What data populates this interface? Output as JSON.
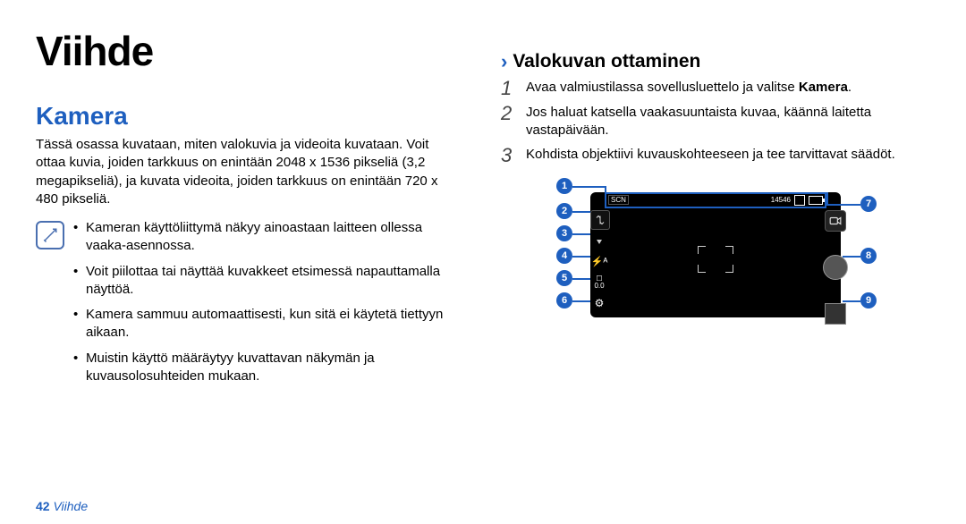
{
  "page_title": "Viihde",
  "left_column": {
    "section_heading": "Kamera",
    "intro": "Tässä osassa kuvataan, miten valokuvia ja videoita kuvataan. Voit ottaa kuvia, joiden tarkkuus on enintään 2048 x 1536 pikseliä (3,2 megapikseliä), ja kuvata videoita, joiden tarkkuus on enintään 720 x 480 pikseliä.",
    "notes": [
      "Kameran käyttöliittymä näkyy ainoastaan laitteen ollessa vaaka-asennossa.",
      "Voit piilottaa tai näyttää kuvakkeet etsimessä napauttamalla näyttöä.",
      "Kamera sammuu automaattisesti, kun sitä ei käytetä tiettyyn aikaan.",
      "Muistin käyttö määräytyy kuvattavan näkymän ja kuvausolosuhteiden mukaan."
    ]
  },
  "right_column": {
    "sub_heading": "Valokuvan ottaminen",
    "steps": [
      {
        "num": "1",
        "text_before": "Avaa valmiustilassa sovellusluettelo ja valitse ",
        "bold": "Kamera",
        "text_after": "."
      },
      {
        "num": "2",
        "text_before": "Jos haluat katsella vaakasuuntaista kuvaa, käännä laitetta vastapäivään.",
        "bold": "",
        "text_after": ""
      },
      {
        "num": "3",
        "text_before": "Kohdista objektiivi kuvauskohteeseen ja tee tarvittavat säädöt.",
        "bold": "",
        "text_after": ""
      }
    ],
    "camera_ui": {
      "scene_label": "SCN",
      "shots_remaining": "14546",
      "callouts": [
        "1",
        "2",
        "3",
        "4",
        "5",
        "6",
        "7",
        "8",
        "9"
      ]
    }
  },
  "footer": {
    "page_number": "42",
    "section_name": "Viihde"
  }
}
